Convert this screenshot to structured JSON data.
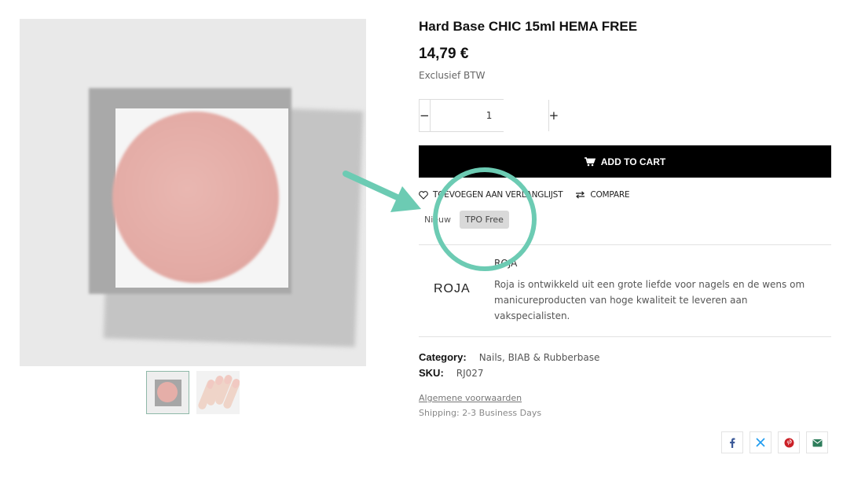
{
  "product": {
    "title": "Hard Base CHIC 15ml HEMA FREE",
    "price": "14,79 €",
    "price_note": "Exclusief BTW"
  },
  "quantity": {
    "minus": "−",
    "value": "1",
    "plus": "+"
  },
  "cart": {
    "label": "ADD TO CART",
    "icon": "cart-icon"
  },
  "actions": {
    "wishlist": "TOEVOEGEN AAN VERLANGLIJST",
    "compare": "COMPARE"
  },
  "tags": [
    "Nieuw",
    "TPO Free"
  ],
  "brand": {
    "logo_text": "ROJA",
    "name": "ROJA",
    "description": "Roja is ontwikkeld uit een grote liefde voor nagels en de wens om manicureproducten van hoge kwaliteit te leveren aan vakspecialisten."
  },
  "meta": {
    "category_label": "Category:",
    "category_value": "Nails, BIAB & Rubberbase",
    "sku_label": "SKU:",
    "sku_value": "RJ027"
  },
  "links": {
    "terms": "Algemene voorwaarden",
    "shipping": "Shipping: 2-3 Business Days"
  },
  "share": [
    "facebook-icon",
    "x-icon",
    "pinterest-icon",
    "email-icon"
  ],
  "colors": {
    "annotation": "#6ccbb3",
    "button_bg": "#000000",
    "tag_active_bg": "#d9d9d9",
    "facebook": "#3b5998",
    "x": "#1d9bf0",
    "pinterest": "#cb2027",
    "email": "#2e7d5b"
  }
}
